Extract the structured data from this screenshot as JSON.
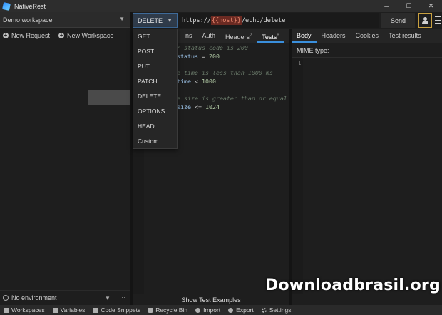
{
  "window": {
    "title": "NativeRest",
    "controls": {
      "minimize": "─",
      "maximize": "☐",
      "close": "✕"
    }
  },
  "left_panel": {
    "workspace": "Demo workspace",
    "actions": {
      "new_request": "New Request",
      "new_workspace": "New Workspace"
    },
    "environment": "No environment",
    "more": "···"
  },
  "request": {
    "method": "DELETE",
    "url_prefix": "https://",
    "url_variable": "{{host}}",
    "url_suffix": "/echo/delete",
    "send_label": "Send",
    "tabs": [
      {
        "label": "ns",
        "badge": ""
      },
      {
        "label": "Auth",
        "badge": ""
      },
      {
        "label": "Headers",
        "badge": "2"
      },
      {
        "label": "Tests",
        "badge": "8",
        "active": true
      }
    ],
    "code": [
      {
        "comment": "r status code is 200"
      },
      {
        "kw": "status",
        "op": " = ",
        "num": "200"
      },
      {
        "comment": "e time is less than 1000 ms"
      },
      {
        "kw": "time",
        "op": " < ",
        "num": "1000"
      },
      {
        "comment": "e size is greater than or equal to"
      },
      {
        "kw": "size",
        "op": " <= ",
        "num": "1024"
      }
    ],
    "show_examples": "Show Test Examples"
  },
  "method_dropdown": {
    "options": [
      "GET",
      "POST",
      "PUT",
      "PATCH",
      "DELETE",
      "OPTIONS",
      "HEAD",
      "Custom..."
    ]
  },
  "response": {
    "tabs": [
      {
        "label": "Body",
        "active": true
      },
      {
        "label": "Headers"
      },
      {
        "label": "Cookies"
      },
      {
        "label": "Test results"
      }
    ],
    "mime_label": "MIME type:",
    "line_number": "1"
  },
  "statusbar": {
    "items": [
      "Workspaces",
      "Variables",
      "Code Snippets",
      "Recycle Bin",
      "Import",
      "Export",
      "Settings"
    ]
  },
  "watermark": "Downloadbrasil.org",
  "colors": {
    "accent": "#3a8fdc",
    "url_variable_bg": "#6b2a22",
    "user_button_border": "#c8a040"
  }
}
